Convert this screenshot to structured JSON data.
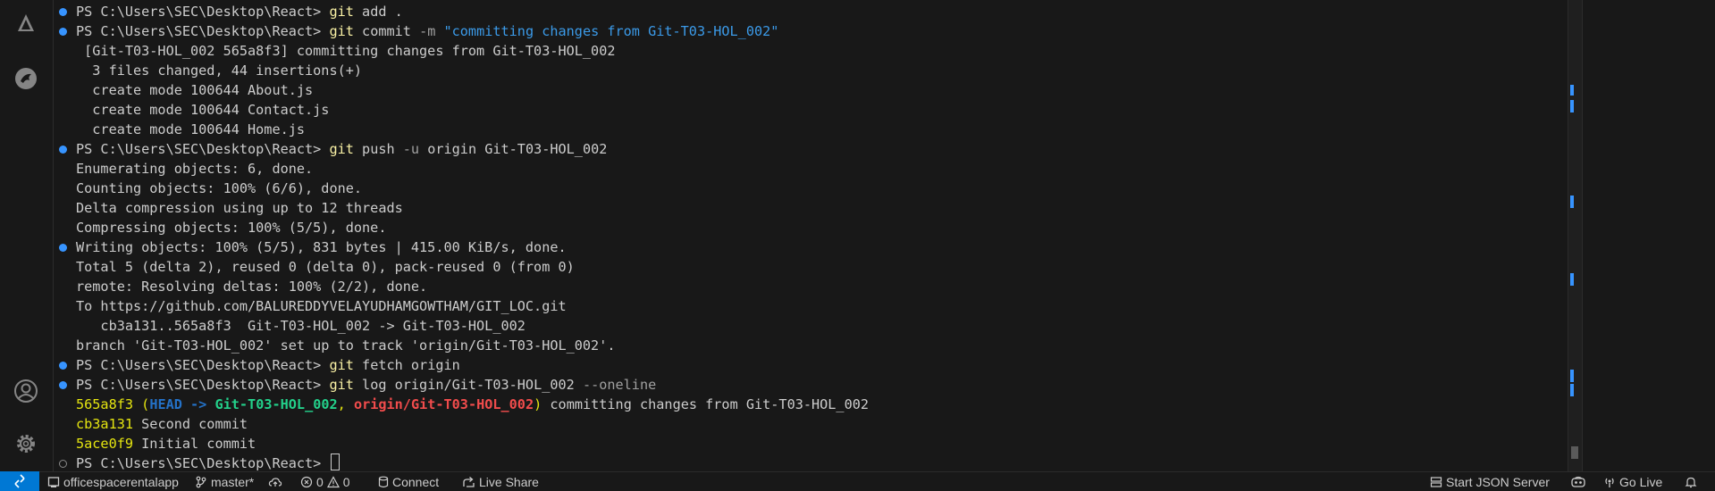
{
  "activity_bar": {
    "top_icons": [
      "source-control-icon",
      "remote-explorer-icon"
    ],
    "bottom_icons": [
      "account-icon",
      "settings-gear-icon"
    ]
  },
  "terminal": {
    "prompt": "PS C:\\Users\\SEC\\Desktop\\React>",
    "lines": {
      "l1": {
        "cmd": "git",
        "args": " add ."
      },
      "l2": {
        "cmd": "git",
        "args": " commit ",
        "flag": "-m",
        "str": " \"committing changes from Git-T03-HOL_002\""
      },
      "l3": " [Git-T03-HOL_002 565a8f3] committing changes from Git-T03-HOL_002",
      "l4": "  3 files changed, 44 insertions(+)",
      "l5": "  create mode 100644 About.js",
      "l6": "  create mode 100644 Contact.js",
      "l7": "  create mode 100644 Home.js",
      "l8": {
        "cmd": "git",
        "args1": " push ",
        "flag": "-u",
        "args2": " origin Git-T03-HOL_002"
      },
      "l9": "Enumerating objects: 6, done.",
      "l10": "Counting objects: 100% (6/6), done.",
      "l11": "Delta compression using up to 12 threads",
      "l12": "Compressing objects: 100% (5/5), done.",
      "l13": "Writing objects: 100% (5/5), 831 bytes | 415.00 KiB/s, done.",
      "l14": "Total 5 (delta 2), reused 0 (delta 0), pack-reused 0 (from 0)",
      "l15": "remote: Resolving deltas: 100% (2/2), done.",
      "l16": "To https://github.com/BALUREDDYVELAYUDHAMGOWTHAM/GIT_LOC.git",
      "l17": "   cb3a131..565a8f3  Git-T03-HOL_002 -> Git-T03-HOL_002",
      "l18": "branch 'Git-T03-HOL_002' set up to track 'origin/Git-T03-HOL_002'.",
      "l19": {
        "cmd": "git",
        "args": " fetch origin"
      },
      "l20": {
        "cmd": "git",
        "args": " log origin/Git-T03-HOL_002 ",
        "flag": "--oneline"
      },
      "l21": {
        "hash": "565a8f3",
        "open": " (",
        "head": "HEAD ->",
        "sp": " ",
        "branch": "Git-T03-HOL_002",
        "comma": ", ",
        "remote": "origin/Git-T03-HOL_002",
        "close": ")",
        "msg": " committing changes from Git-T03-HOL_002"
      },
      "l22": {
        "hash": "cb3a131",
        "msg": " Second commit"
      },
      "l23": {
        "hash": "5ace0f9",
        "msg": " Initial commit"
      }
    }
  },
  "status_bar": {
    "remote_icon": "remote-indicator-icon",
    "project": "officespacerentalapp",
    "branch": "master*",
    "errors": "0",
    "warnings": "0",
    "connect": "Connect",
    "live_share": "Live Share",
    "json_server": "Start JSON Server",
    "go_live": "Go Live",
    "colors": {
      "remote_bg": "#0078d4",
      "accent": "#3794ff"
    }
  }
}
